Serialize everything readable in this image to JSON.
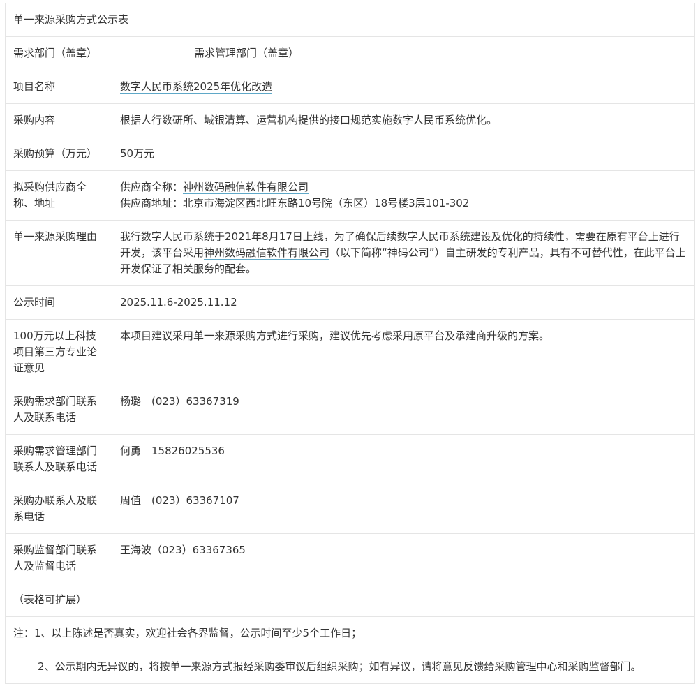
{
  "title": "单一来源采购方式公示表",
  "dept_row": {
    "label": "需求部门（盖章）",
    "value": "",
    "mgmt_label": "需求管理部门（盖章）"
  },
  "project": {
    "label": "项目名称",
    "value": "数字人民币系统2025年优化改造"
  },
  "content": {
    "label": "采购内容",
    "value": "根据人行数研所、城银清算、运营机构提供的接口规范实施数字人民币系统优化。"
  },
  "budget": {
    "label": "采购预算（万元）",
    "value": "50万元"
  },
  "supplier": {
    "label": "拟采购供应商全称、地址",
    "name_prefix": "供应商全称：",
    "name": "神州数码融信软件有限公司",
    "address": "供应商地址：北京市海淀区西北旺东路10号院（东区）18号楼3层101-302"
  },
  "reason": {
    "label": "单一来源采购理由",
    "text1": "我行数字人民币系统于2021年8月17日上线，为了确保后续数字人民币系统建设及优化的持续性，需要在原有平台上进行开发，该平台采用",
    "company": "神州数码融信软件有限公司",
    "text2": "（以下简称“神码公司”）自主研发的专利产品，具有不可替代性，在此平台上开发保证了相关服务的配套。"
  },
  "period": {
    "label": "公示时间",
    "value": "2025.11.6-2025.11.12"
  },
  "expert": {
    "label": "100万元以上科技项目第三方专业论证意见",
    "value": "本项目建议采用单一来源采购方式进行采购，建议优先考虑采用原平台及承建商升级的方案。"
  },
  "contact_req": {
    "label": "采购需求部门联系人及联系电话",
    "value": "杨璐　(023）63367319"
  },
  "contact_mgmt": {
    "label": "采购需求管理部门联系人及联系电话",
    "value": "何勇　15826025536"
  },
  "contact_office": {
    "label": "采购办联系人及联系电话",
    "value": "周值　(023）63367107"
  },
  "contact_supervise": {
    "label": "采购监督部门联系人及监督电话",
    "value": "王海波（023）63367365"
  },
  "expandable": {
    "label": "（表格可扩展）"
  },
  "notes": {
    "note1": "注：1、以上陈述是否真实，欢迎社会各界监督，公示时间至少5个工作日；",
    "note2": "2、公示期内无异议的，将按单一来源方式报经采购委审议后组织采购；如有异议，请将意见反馈给采购管理中心和采购监督部门。"
  }
}
